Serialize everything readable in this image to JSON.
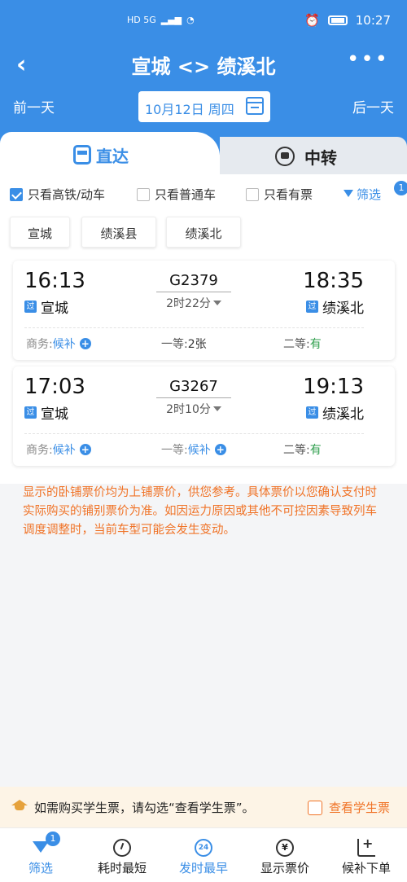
{
  "status_bar": {
    "network": "HD 5G",
    "time": "10:27"
  },
  "nav": {
    "title": "宣城 <> 绩溪北"
  },
  "date_bar": {
    "prev_label": "前一天",
    "date": "10月12日 周四",
    "next_label": "后一天"
  },
  "tabs": [
    {
      "label": "直达",
      "active": true
    },
    {
      "label": "中转",
      "active": false
    }
  ],
  "filters": {
    "options": [
      {
        "label": "只看高铁/动车",
        "checked": true
      },
      {
        "label": "只看普通车",
        "checked": false
      },
      {
        "label": "只看有票",
        "checked": false
      }
    ],
    "filter_label": "筛选",
    "filter_badge": "1"
  },
  "stations": [
    "宣城",
    "绩溪县",
    "绩溪北"
  ],
  "trains": [
    {
      "dep_time": "16:13",
      "arr_time": "18:35",
      "train_no": "G2379",
      "duration": "2时22分",
      "dep_station": "宣城",
      "arr_station": "绩溪北",
      "pass_tag": "过",
      "seats": [
        {
          "label": "商务:",
          "value": "候补",
          "kind": "waitlist"
        },
        {
          "label": "一等:",
          "value": "2张",
          "kind": "count"
        },
        {
          "label": "二等:",
          "value": "有",
          "kind": "available"
        }
      ]
    },
    {
      "dep_time": "17:03",
      "arr_time": "19:13",
      "train_no": "G3267",
      "duration": "2时10分",
      "dep_station": "宣城",
      "arr_station": "绩溪北",
      "pass_tag": "过",
      "seats": [
        {
          "label": "商务:",
          "value": "候补",
          "kind": "waitlist"
        },
        {
          "label": "一等:",
          "value": "候补",
          "kind": "waitlist"
        },
        {
          "label": "二等:",
          "value": "有",
          "kind": "available"
        }
      ]
    }
  ],
  "notice": "显示的卧铺票价均为上铺票价，供您参考。具体票价以您确认支付时实际购买的铺别票价为准。如因运力原因或其他不可控因素导致列车调度调整时，当前车型可能会发生变动。",
  "student": {
    "text": "如需购买学生票，请勾选“查看学生票”。",
    "check_label": "查看学生票"
  },
  "bottom_nav": [
    {
      "label": "筛选",
      "icon": "funnel-icon",
      "badge": "1"
    },
    {
      "label": "耗时最短",
      "icon": "clock-icon"
    },
    {
      "label": "发时最早",
      "icon": "clock-24-icon"
    },
    {
      "label": "显示票价",
      "icon": "yen-icon"
    },
    {
      "label": "候补下单",
      "icon": "cart-plus-icon"
    }
  ],
  "colors": {
    "primary": "#3a8ee6",
    "available": "#2e9e4c",
    "notice": "#f07327"
  }
}
